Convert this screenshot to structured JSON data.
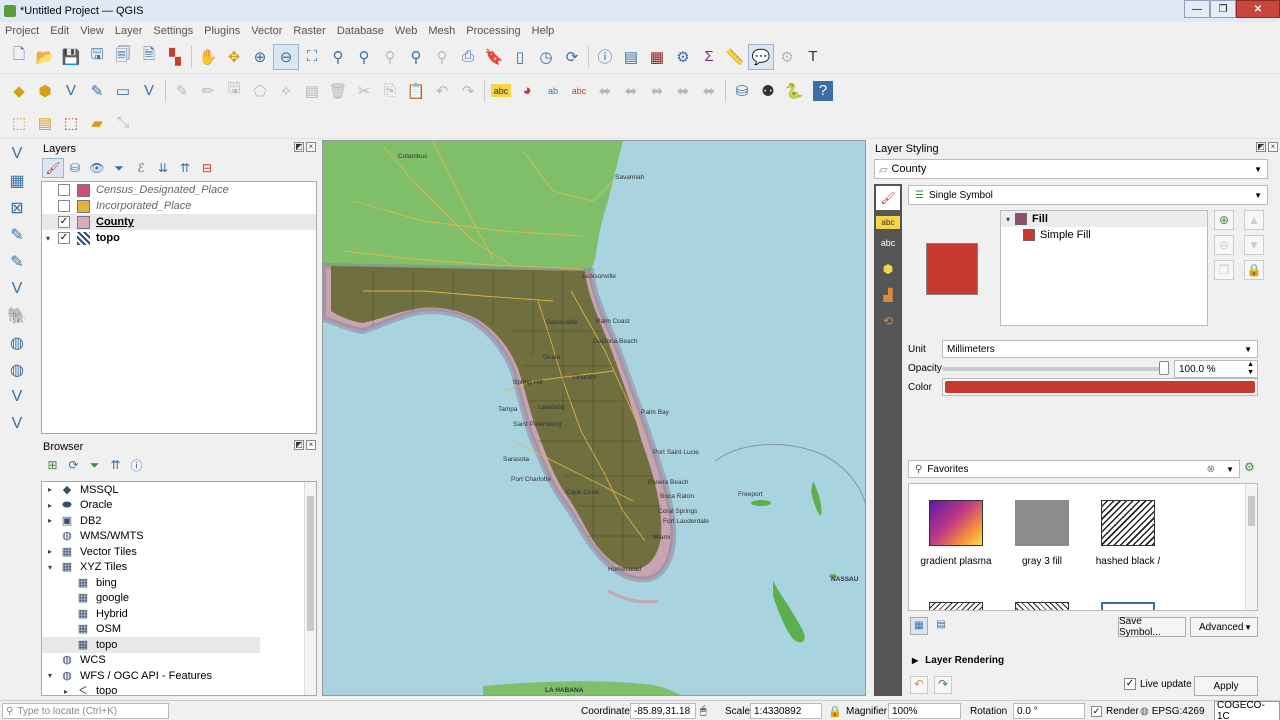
{
  "window": {
    "title": "*Untitled Project — QGIS",
    "controls": {
      "minimize": "—",
      "maximize": "❐",
      "close": "✕"
    }
  },
  "menu": [
    "Project",
    "Edit",
    "View",
    "Layer",
    "Settings",
    "Plugins",
    "Vector",
    "Raster",
    "Database",
    "Web",
    "Mesh",
    "Processing",
    "Help"
  ],
  "layers_panel": {
    "title": "Layers",
    "layers": [
      {
        "name": "Census_Designated_Place",
        "checked": false,
        "color": "#cf4f7a",
        "style": "italic"
      },
      {
        "name": "Incorporated_Place",
        "checked": false,
        "color": "#e2b23d",
        "style": "italic"
      },
      {
        "name": "County",
        "checked": true,
        "color": "#d8a9bf",
        "style": "selected"
      },
      {
        "name": "topo",
        "checked": true,
        "color": "",
        "style": "bold"
      }
    ]
  },
  "browser_panel": {
    "title": "Browser",
    "items": [
      {
        "label": "MSSQL",
        "icon": "mssql-icon",
        "glyph": "◆",
        "indent": 0,
        "arrow": "▸"
      },
      {
        "label": "Oracle",
        "icon": "oracle-icon",
        "glyph": "⬬",
        "indent": 0,
        "arrow": "▸"
      },
      {
        "label": "DB2",
        "icon": "db2-icon",
        "glyph": "▣",
        "indent": 0,
        "arrow": "▸"
      },
      {
        "label": "WMS/WMTS",
        "icon": "globe-icon",
        "glyph": "◍",
        "indent": 0,
        "arrow": ""
      },
      {
        "label": "Vector Tiles",
        "icon": "grid-icon",
        "glyph": "▦",
        "indent": 0,
        "arrow": "▸"
      },
      {
        "label": "XYZ Tiles",
        "icon": "grid-icon",
        "glyph": "▦",
        "indent": 0,
        "arrow": "▾"
      },
      {
        "label": "bing",
        "icon": "tile-icon",
        "glyph": "▦",
        "indent": 1,
        "arrow": ""
      },
      {
        "label": "google",
        "icon": "tile-icon",
        "glyph": "▦",
        "indent": 1,
        "arrow": ""
      },
      {
        "label": "Hybrid",
        "icon": "tile-icon",
        "glyph": "▦",
        "indent": 1,
        "arrow": ""
      },
      {
        "label": "OSM",
        "icon": "tile-icon",
        "glyph": "▦",
        "indent": 1,
        "arrow": ""
      },
      {
        "label": "topo",
        "icon": "tile-icon",
        "glyph": "▦",
        "indent": 1,
        "arrow": ""
      },
      {
        "label": "WCS",
        "icon": "globe-icon",
        "glyph": "◍",
        "indent": 0,
        "arrow": ""
      },
      {
        "label": "WFS / OGC API - Features",
        "icon": "globe-icon",
        "glyph": "◍",
        "indent": 0,
        "arrow": "▾"
      },
      {
        "label": "topo",
        "icon": "vector-icon",
        "glyph": "ᐸ",
        "indent": 1,
        "arrow": "▸"
      }
    ]
  },
  "map": {
    "labels": {
      "columbus": "Columbus",
      "savannah": "Savannah",
      "jacksonville": "Jacksonville",
      "palm_coast": "Palm Coast",
      "daytona": "Daytona Beach",
      "palm_bay": "Palm Bay",
      "port_st_lucie": "Port Saint Lucie",
      "west_palm": "Riviera Beach",
      "boca": "Boca Raton",
      "coral_springs": "Coral Springs",
      "fort_lauderdale": "Fort Lauderdale",
      "miami": "Miami",
      "tampa": "Tampa",
      "st_pete": "Saint Petersburg",
      "sarasota": "Sarasota",
      "port_charlotte": "Port Charlotte",
      "cape_coral": "Cape Coral",
      "homestead": "Homestead",
      "freeport": "Freeport",
      "nassau": "NASSAU",
      "la_habana": "LA HABANA",
      "lakeland": "Lakeland",
      "spring_hill": "Spring Hill",
      "gainesville": "Gainesville",
      "ocala": "Ocala",
      "orlando": "Orlando"
    }
  },
  "style_panel": {
    "title": "Layer Styling",
    "layer": "County",
    "renderer": "Single Symbol",
    "tree": {
      "root": "Fill",
      "child": "Simple Fill",
      "root_color": "#8e4f6e",
      "child_color": "#c8392f"
    },
    "unit_label": "Unit",
    "unit_value": "Millimeters",
    "opacity_label": "Opacity",
    "opacity_value": "100.0 %",
    "opacity": 1.0,
    "color_label": "Color",
    "fill_color": "#c8392f",
    "favorites": "Favorites",
    "symbols": [
      {
        "label": "gradient plasma"
      },
      {
        "label": "gray 3 fill"
      },
      {
        "label": "hashed black /"
      }
    ],
    "save_symbol": "Save Symbol...",
    "advanced": "Advanced",
    "layer_rendering": "Layer Rendering",
    "live_update": "Live update",
    "apply": "Apply"
  },
  "status": {
    "locator_placeholder": "Type to locate (Ctrl+K)",
    "coordinate_label": "Coordinate",
    "coordinate": "-85.89,31.18",
    "scale_label": "Scale",
    "scale": "1:4330892",
    "magnifier_label": "Magnifier",
    "magnifier": "100%",
    "rotation_label": "Rotation",
    "rotation": "0.0 °",
    "render_label": "Render",
    "crs": "EPSG:4269",
    "tooltip": "COGECO-1C"
  },
  "colors": {
    "accent": "#3a6ea5",
    "fill": "#c8392f",
    "land_fl": "#6b6b3a",
    "water": "#a9d3df"
  }
}
